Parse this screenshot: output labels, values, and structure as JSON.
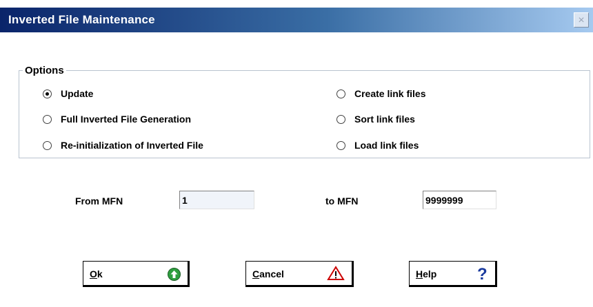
{
  "window": {
    "title": "Inverted File Maintenance",
    "close_glyph": "×"
  },
  "options": {
    "label": "Options",
    "items": [
      {
        "label": "Update",
        "checked": true
      },
      {
        "label": "Full Inverted File Generation",
        "checked": false
      },
      {
        "label": "Re-initialization of Inverted File",
        "checked": false
      },
      {
        "label": "Create link files",
        "checked": false
      },
      {
        "label": "Sort link files",
        "checked": false
      },
      {
        "label": "Load link files",
        "checked": false
      }
    ]
  },
  "range": {
    "from_label": "From MFN",
    "from_value": "1",
    "to_label": "to MFN",
    "to_value": "9999999"
  },
  "buttons": {
    "ok": {
      "accel": "O",
      "rest": "k",
      "icon": "green-up-arrow-icon"
    },
    "cancel": {
      "accel": "C",
      "rest": "ancel",
      "icon": "warning-triangle-icon"
    },
    "help": {
      "accel": "H",
      "rest": "elp",
      "icon": "question-mark-icon"
    }
  },
  "colors": {
    "title_bar_start": "#0a246a",
    "title_bar_end": "#a6caf0",
    "ok_icon": "#2e9e3f",
    "warning_icon": "#cc0000",
    "help_icon": "#1a3a9e"
  }
}
